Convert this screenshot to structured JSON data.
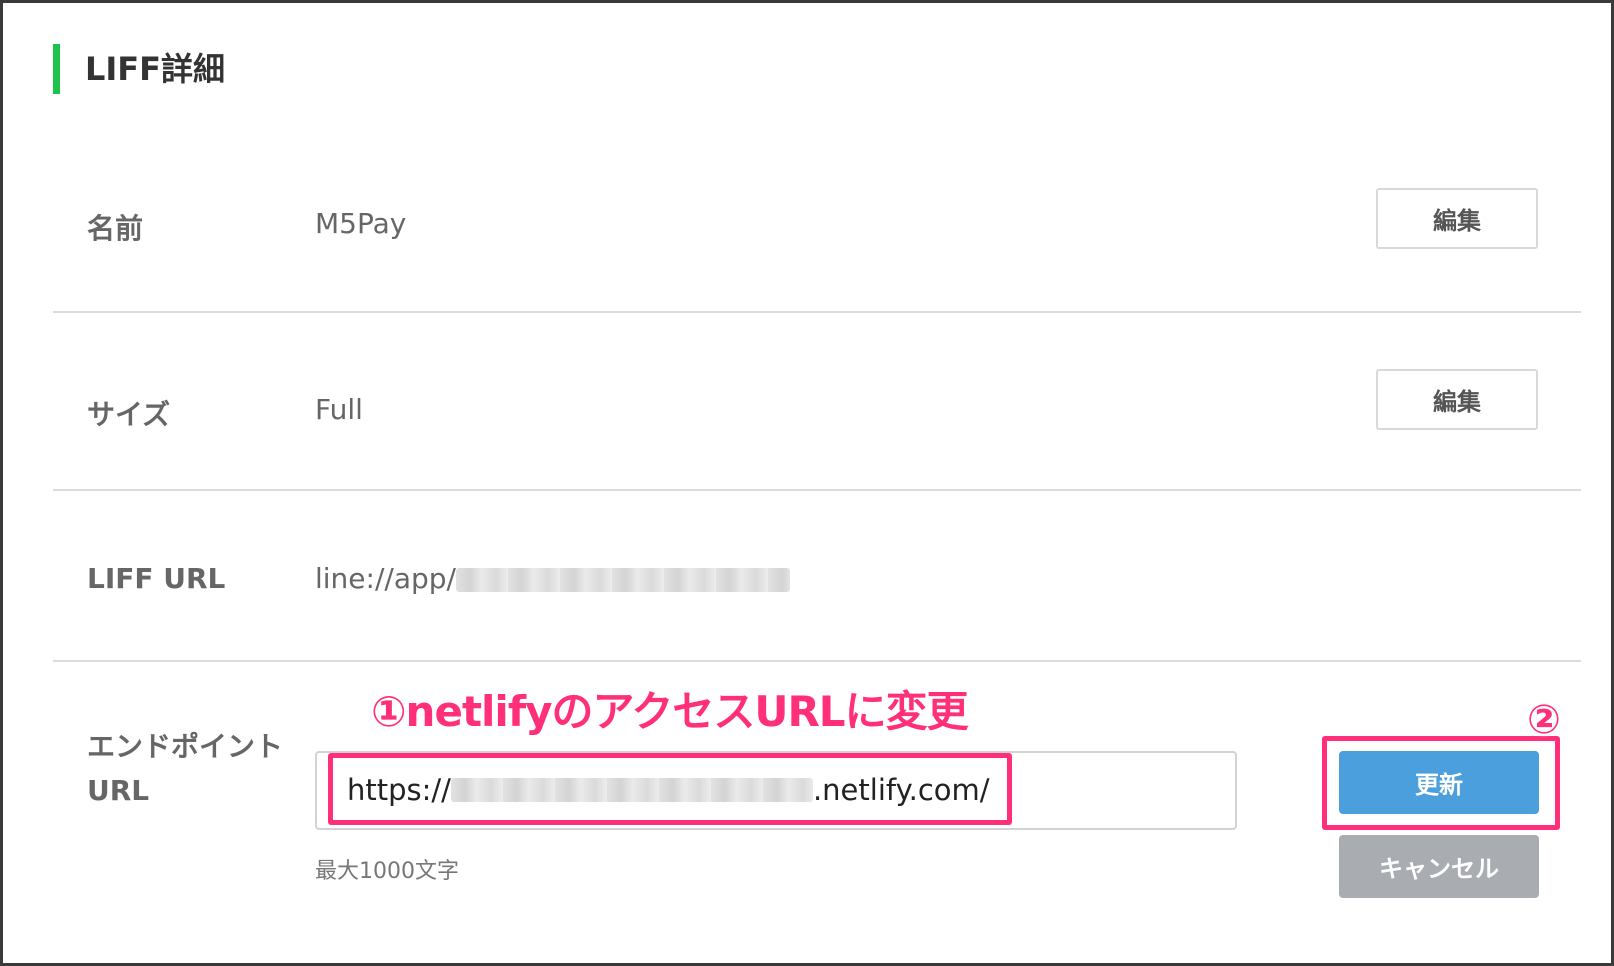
{
  "section": {
    "title": "LIFF詳細"
  },
  "rows": {
    "name": {
      "label": "名前",
      "value": "M5Pay",
      "edit_label": "編集"
    },
    "size": {
      "label": "サイズ",
      "value": "Full",
      "edit_label": "編集"
    },
    "liff_url": {
      "label": "LIFF URL",
      "value_prefix": "line://app/"
    },
    "endpoint": {
      "label_line1": "エンドポイント",
      "label_line2": "URL",
      "input_prefix": "https://",
      "input_suffix": ".netlify.com/",
      "helper": "最大1000文字",
      "update_label": "更新",
      "cancel_label": "キャンセル"
    }
  },
  "annotations": {
    "step1": "①netlifyのアクセスURLに変更",
    "step2": "②"
  },
  "colors": {
    "accent_green": "#1fc24a",
    "update_blue": "#4a9fdc",
    "cancel_gray": "#a9adb2",
    "annotation_pink": "#ff2f7a"
  }
}
